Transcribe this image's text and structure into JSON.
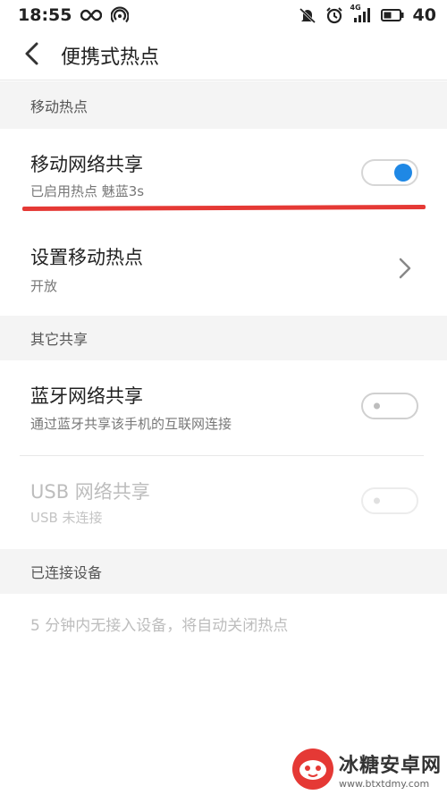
{
  "status_bar": {
    "time": "18:55",
    "battery": "40",
    "network_label": "4G",
    "icons": [
      "infinity-icon",
      "hotspot-signal-icon",
      "mute-icon",
      "alarm-icon",
      "cell-signal-icon",
      "wifi-icon"
    ]
  },
  "app_bar": {
    "title": "便携式热点"
  },
  "sections": {
    "mobile_hotspot": {
      "header": "移动热点",
      "mobile_share": {
        "title": "移动网络共享",
        "subtitle": "已启用热点 魅蓝3s",
        "enabled": true
      },
      "hotspot_setup": {
        "title": "设置移动热点",
        "subtitle": "开放"
      }
    },
    "other_sharing": {
      "header": "其它共享",
      "bluetooth": {
        "title": "蓝牙网络共享",
        "subtitle": "通过蓝牙共享该手机的互联网连接",
        "enabled": false
      },
      "usb": {
        "title": "USB 网络共享",
        "subtitle": "USB 未连接",
        "enabled": false,
        "disabled": true
      }
    },
    "connected_devices": {
      "header": "已连接设备",
      "hint": "5 分钟内无接入设备，将自动关闭热点"
    }
  },
  "watermark": {
    "text": "冰糖安卓网",
    "url": "www.btxtdmy.com"
  },
  "colors": {
    "accent": "#1f88e5",
    "highlight_line": "#e53935",
    "section_bg": "#f4f4f4"
  }
}
